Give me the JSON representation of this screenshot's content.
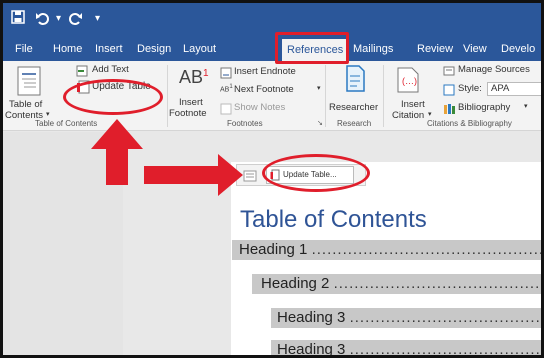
{
  "tabs": [
    "File",
    "Home",
    "Insert",
    "Design",
    "Layout",
    "References",
    "Mailings",
    "Review",
    "View",
    "Develo"
  ],
  "active_tab": "References",
  "ribbon": {
    "toc_group": {
      "add_text": "Add Text",
      "update_table": "Update Table",
      "table_of_contents_line1": "Table of",
      "table_of_contents_line2": "Contents",
      "label": "Table of Contents"
    },
    "footnotes_group": {
      "insert_footnote_line1": "Insert",
      "insert_footnote_line2": "Footnote",
      "insert_endnote": "Insert Endnote",
      "next_footnote": "Next Footnote",
      "show_notes": "Show Notes",
      "label": "Footnotes"
    },
    "research_group": {
      "researcher": "Researcher",
      "label": "Research"
    },
    "citations_group": {
      "insert_citation_line1": "Insert",
      "insert_citation_line2": "Citation",
      "manage_sources": "Manage Sources",
      "style_label": "Style:",
      "style_value": "APA",
      "bibliography": "Bibliography",
      "label": "Citations & Bibliography"
    }
  },
  "popup": {
    "update_table_button": "Update Table..."
  },
  "document": {
    "toc_title": "Table of Contents",
    "entries": [
      {
        "text": "Heading 1",
        "dots": "........................................................"
      },
      {
        "text": "Heading 2",
        "dots": "........................................................"
      },
      {
        "text": "Heading 3",
        "dots": "........................................................"
      },
      {
        "text": "Heading 3",
        "dots": "........................................................"
      }
    ]
  },
  "colors": {
    "word_blue": "#2b579a",
    "annotation_red": "#e01e2b",
    "heading_blue": "#2f5496",
    "toc_field_gray": "#c8c8c8"
  }
}
